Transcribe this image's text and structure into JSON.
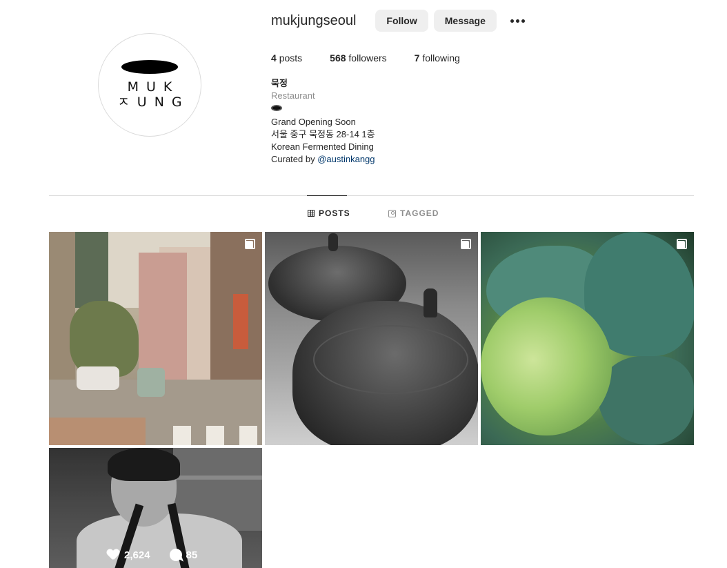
{
  "profile": {
    "username": "mukjungseoul",
    "follow_label": "Follow",
    "message_label": "Message",
    "logo_line1": "MUK",
    "logo_line2": "ㅈUNG"
  },
  "stats": {
    "posts_count": "4",
    "posts_label": "posts",
    "followers_count": "568",
    "followers_label": "followers",
    "following_count": "7",
    "following_label": "following"
  },
  "bio": {
    "name": "묵정",
    "category": "Restaurant",
    "line1": "Grand Opening Soon",
    "line2": "서울 중구 묵정동 28-14 1층",
    "line3": "Korean Fermented Dining",
    "line4_prefix": "Curated by ",
    "line4_link": "@austinkangg"
  },
  "tabs": {
    "posts": "POSTS",
    "tagged": "TAGGED"
  },
  "posts": [
    {
      "type": "carousel",
      "subject": "street-scene"
    },
    {
      "type": "carousel",
      "subject": "earthen-pots"
    },
    {
      "type": "carousel",
      "subject": "cabbage"
    },
    {
      "type": "photo",
      "subject": "chef",
      "likes": "2,624",
      "comments": "85"
    }
  ],
  "colors": {
    "text": "#262626",
    "muted": "#8e8e8e",
    "link": "#00376b",
    "button_bg": "#efefef",
    "divider": "#dbdbdb"
  },
  "icons": [
    "more-options-icon",
    "grid-icon",
    "tagged-icon",
    "carousel-icon",
    "heart-icon",
    "comment-icon"
  ]
}
